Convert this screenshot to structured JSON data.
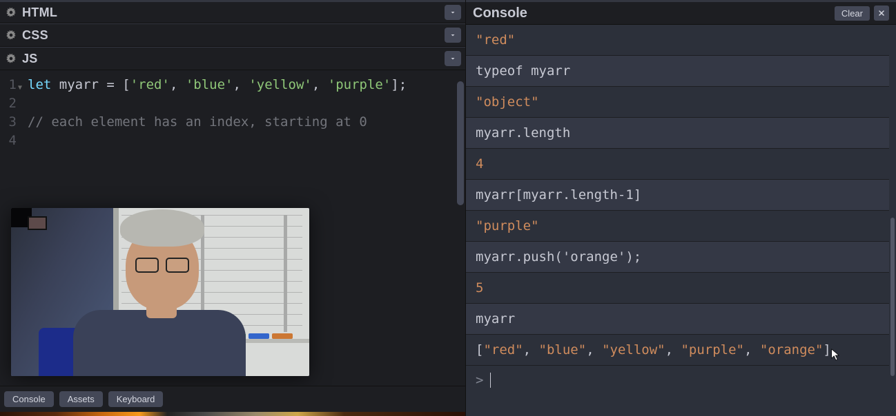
{
  "panels": {
    "html": {
      "title": "HTML"
    },
    "css": {
      "title": "CSS"
    },
    "js": {
      "title": "JS"
    }
  },
  "editor": {
    "line1_kw": "let",
    "line1_id": " myarr ",
    "line1_eq": "= [",
    "line1_s1": "'red'",
    "line1_c1": ", ",
    "line1_s2": "'blue'",
    "line1_c2": ", ",
    "line1_s3": "'yellow'",
    "line1_c3": ", ",
    "line1_s4": "'purple'",
    "line1_end": "];",
    "line3_comment": "// each element has an index, starting at 0",
    "gutter": [
      "1",
      "2",
      "3",
      "4"
    ]
  },
  "bottom_bar": {
    "console": "Console",
    "assets": "Assets",
    "keyboard": "Keyboard"
  },
  "console": {
    "title": "Console",
    "clear": "Clear",
    "rows": [
      {
        "kind": "output",
        "type": "string",
        "value": "\"red\""
      },
      {
        "kind": "input",
        "type": "code",
        "value": "typeof myarr"
      },
      {
        "kind": "output",
        "type": "string",
        "value": "\"object\""
      },
      {
        "kind": "input",
        "type": "code",
        "value": "myarr.length"
      },
      {
        "kind": "output",
        "type": "number",
        "value": "4"
      },
      {
        "kind": "input",
        "type": "code",
        "value": "myarr[myarr.length-1]"
      },
      {
        "kind": "output",
        "type": "string",
        "value": "\"purple\""
      },
      {
        "kind": "input",
        "type": "code",
        "value": "myarr.push('orange');"
      },
      {
        "kind": "output",
        "type": "number",
        "value": "5"
      },
      {
        "kind": "input",
        "type": "code",
        "value": "myarr"
      },
      {
        "kind": "output",
        "type": "array",
        "value_parts": [
          "[",
          "\"red\"",
          ", ",
          "\"blue\"",
          ", ",
          "\"yellow\"",
          ", ",
          "\"purple\"",
          ", ",
          "\"orange\"",
          "]"
        ]
      }
    ],
    "prompt_symbol": ">"
  }
}
